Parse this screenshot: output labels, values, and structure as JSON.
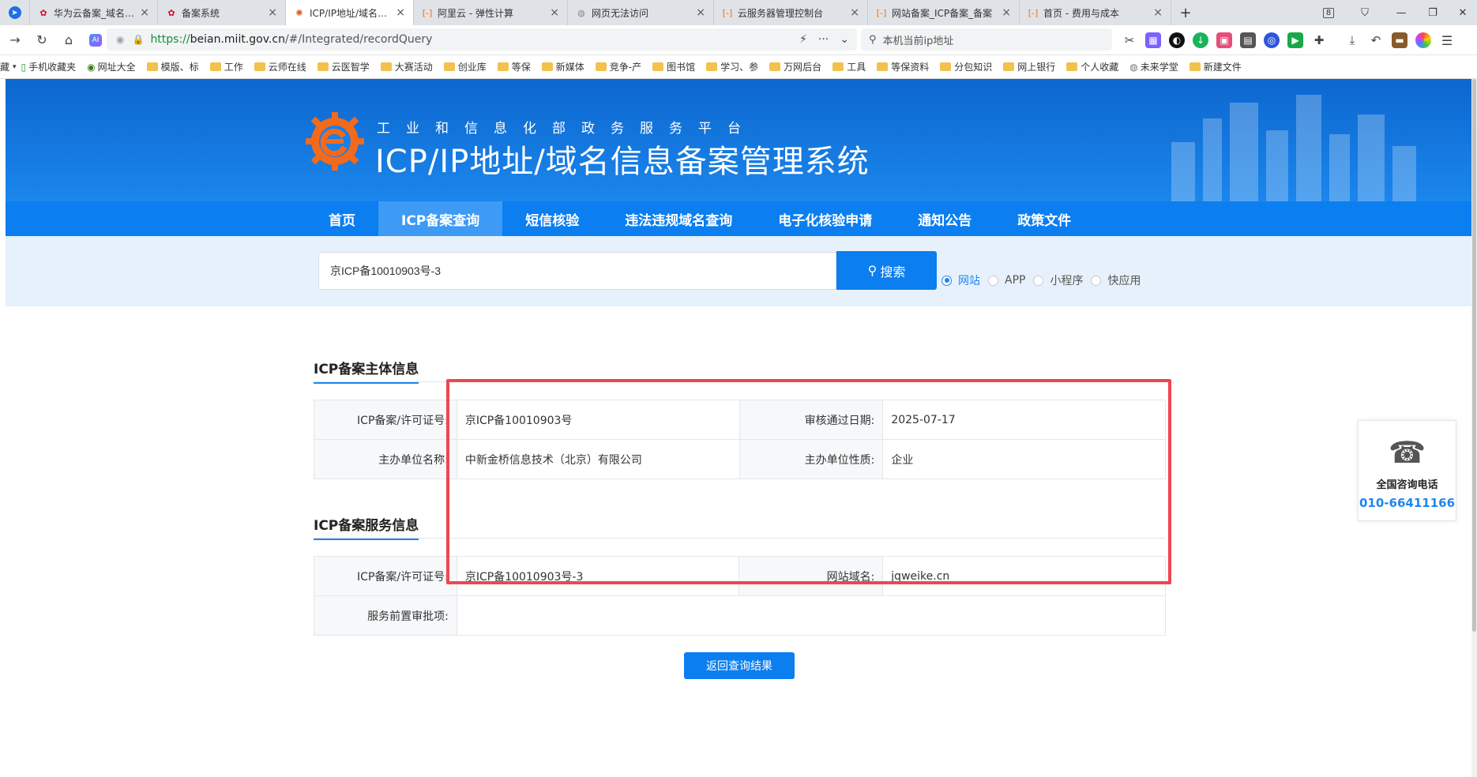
{
  "browser": {
    "tabs": [
      {
        "label": "华为云备案_域名ICP备案",
        "icon": "huawei-icon",
        "color": "#cf0a2c",
        "active": false
      },
      {
        "label": "备案系统",
        "icon": "huawei-icon",
        "color": "#cf0a2c",
        "active": false
      },
      {
        "label": "ICP/IP地址/域名信息备案",
        "icon": "miit-icon",
        "color": "#e85a1c",
        "active": true
      },
      {
        "label": "阿里云 - 弹性计算",
        "icon": "aliyun-icon",
        "color": "#ff6a00",
        "active": false
      },
      {
        "label": "网页无法访问",
        "icon": "globe-icon",
        "color": "#888888",
        "active": false
      },
      {
        "label": "云服务器管理控制台",
        "icon": "aliyun-icon",
        "color": "#ff6a00",
        "active": false
      },
      {
        "label": "网站备案_ICP备案_备案",
        "icon": "aliyun-icon",
        "color": "#ff6a00",
        "active": false
      },
      {
        "label": "首页 - 费用与成本",
        "icon": "aliyun-icon",
        "color": "#ff6a00",
        "active": false
      }
    ],
    "tab_counter": "8",
    "url": {
      "scheme": "https://",
      "host": "beian.miit.gov.cn",
      "path": "/#/Integrated/recordQuery"
    },
    "search_placeholder": "本机当前ip地址",
    "bookmarks": [
      "藏",
      "手机收藏夹",
      "网址大全",
      "模版、标",
      "工作",
      "云师在线",
      "云医智学",
      "大赛活动",
      "创业库",
      "等保",
      "新媒体",
      "竞争-产",
      "图书馆",
      "学习、参",
      "万网后台",
      "工具",
      "等保资料",
      "分包知识",
      "网上银行",
      "个人收藏",
      "未来学堂",
      "新建文件"
    ]
  },
  "site": {
    "subtitle": "工业和信息化部政务服务平台",
    "title": "ICP/IP地址/域名信息备案管理系统",
    "nav": [
      {
        "label": "首页",
        "active": false
      },
      {
        "label": "ICP备案查询",
        "active": true
      },
      {
        "label": "短信核验",
        "active": false
      },
      {
        "label": "违法违规域名查询",
        "active": false
      },
      {
        "label": "电子化核验申请",
        "active": false
      },
      {
        "label": "通知公告",
        "active": false
      },
      {
        "label": "政策文件",
        "active": false
      }
    ],
    "search": {
      "value": "京ICP备10010903号-3",
      "button": "搜索",
      "options": [
        {
          "label": "网站",
          "checked": true
        },
        {
          "label": "APP",
          "checked": false
        },
        {
          "label": "小程序",
          "checked": false
        },
        {
          "label": "快应用",
          "checked": false
        }
      ]
    },
    "subject_section": {
      "title": "ICP备案主体信息",
      "rows": [
        {
          "l1": "ICP备案/许可证号:",
          "v1": "京ICP备10010903号",
          "l2": "审核通过日期:",
          "v2": "2025-07-17"
        },
        {
          "l1": "主办单位名称:",
          "v1": "中新金桥信息技术（北京）有限公司",
          "l2": "主办单位性质:",
          "v2": "企业"
        }
      ]
    },
    "service_section": {
      "title": "ICP备案服务信息",
      "rows": [
        {
          "l1": "ICP备案/许可证号:",
          "v1": "京ICP备10010903号-3",
          "l2": "网站域名:",
          "v2": "jqweike.cn"
        },
        {
          "l1": "服务前置审批项:",
          "v1": ""
        }
      ]
    },
    "back_button": "返回查询结果",
    "contact": {
      "label": "全国咨询电话",
      "phone": "010-66411166"
    },
    "colors": {
      "primary": "#0b7ef0",
      "highlight": "#ef4651"
    }
  }
}
